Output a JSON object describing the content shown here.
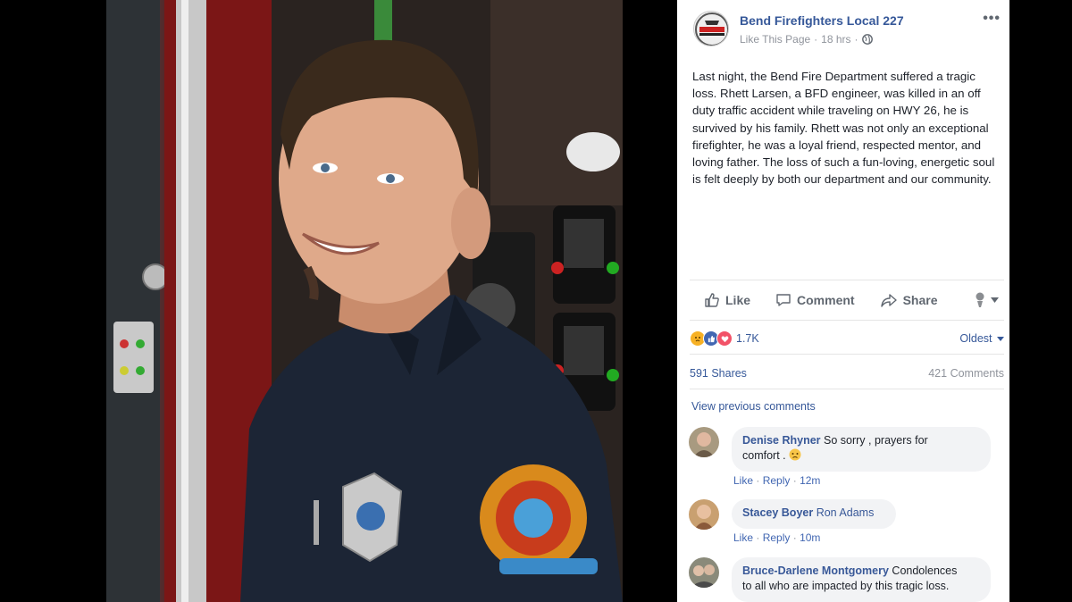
{
  "post": {
    "page_name": "Bend Firefighters Local 227",
    "meta_like": "Like This Page",
    "meta_sep": "·",
    "meta_time": "18 hrs",
    "text": "Last night, the Bend Fire Department suffered a tragic loss. Rhett Larsen, a BFD engineer, was killed in an off duty traffic accident while traveling on HWY 26, he is survived by his family. Rhett was not only an exceptional firefighter, he was a loyal friend, respected mentor, and loving father. The loss of such a fun-loving, energetic soul is felt deeply by both our department and our community."
  },
  "actions": {
    "like": "Like",
    "comment": "Comment",
    "share": "Share"
  },
  "stats": {
    "reaction_count": "1.7K",
    "sort_label": "Oldest",
    "shares": "591 Shares",
    "comments": "421 Comments"
  },
  "view_previous": "View previous comments",
  "comments": [
    {
      "author": "Denise Rhyner",
      "text_line1": " So sorry , prayers for",
      "text_line2": "comfort . ",
      "like": "Like",
      "sep": "·",
      "reply": "Reply",
      "time": "12m"
    },
    {
      "author": "Stacey Boyer",
      "mention": "Ron Adams",
      "like": "Like",
      "sep": "·",
      "reply": "Reply",
      "time": "10m"
    },
    {
      "author": "Bruce-Darlene Montgomery",
      "text_line1": " Condolences",
      "text_line2": "to all who are impacted by this tragic loss."
    }
  ],
  "colors": {
    "link": "#365899",
    "like_blue": "#4267b2",
    "love_red": "#f25268",
    "sad_yellow": "#f7b125"
  }
}
